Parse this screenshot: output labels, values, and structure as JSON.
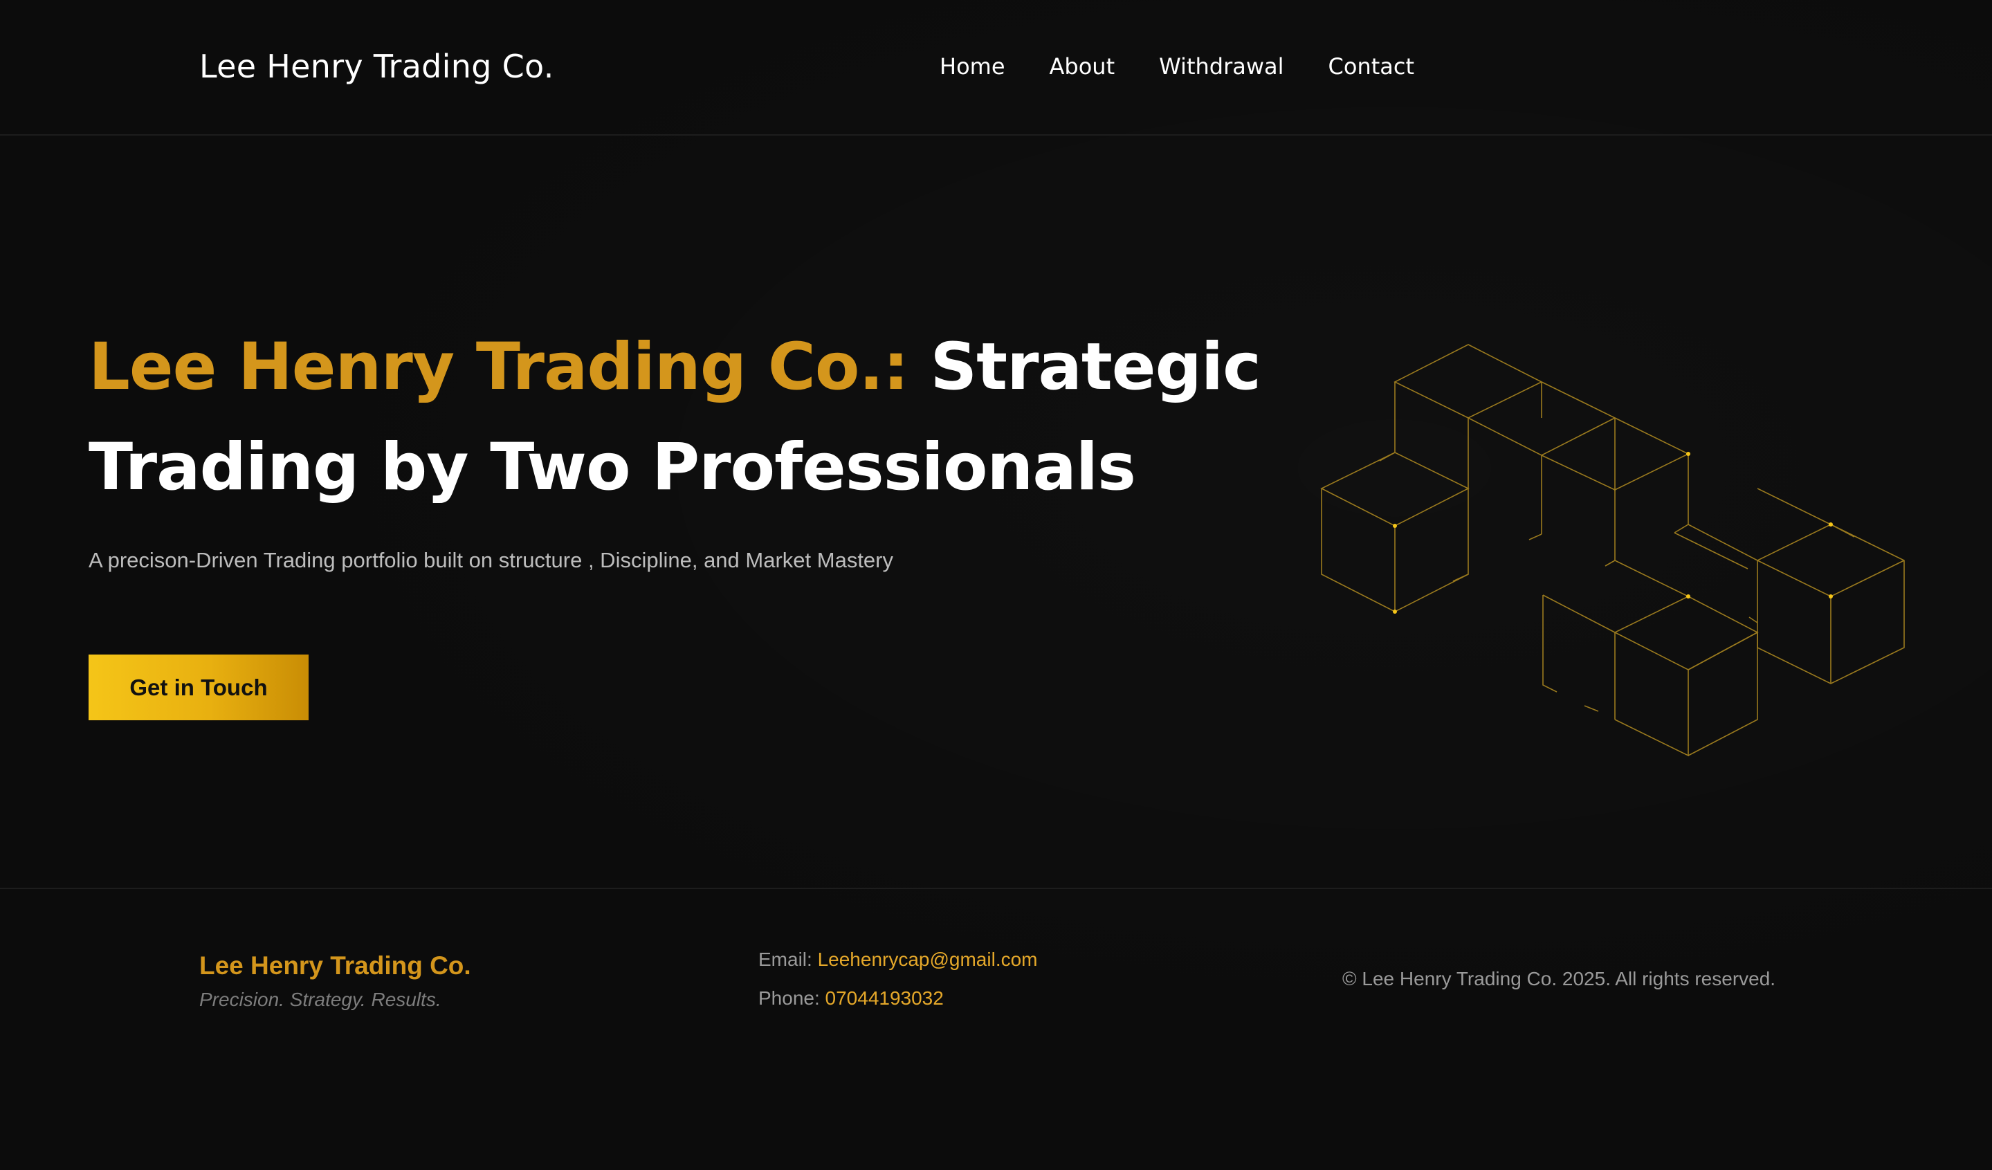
{
  "header": {
    "brand": "Lee Henry Trading Co.",
    "nav": [
      {
        "label": "Home"
      },
      {
        "label": "About"
      },
      {
        "label": "Withdrawal"
      },
      {
        "label": "Contact"
      }
    ]
  },
  "hero": {
    "title_accent": "Lee Henry Trading Co.:",
    "title_rest": "Strategic Trading by Two Professionals",
    "subtitle": "A precison-Driven Trading portfolio built on structure , Discipline, and Market Mastery",
    "cta_label": "Get in Touch",
    "graphic_icon": "isometric-cubes-graphic"
  },
  "footer": {
    "brand": "Lee Henry Trading Co.",
    "tagline": "Precision. Strategy. Results.",
    "email_label": "Email:",
    "email_value": "Leehenrycap@gmail.com",
    "phone_label": "Phone:",
    "phone_value": "07044193032",
    "copyright": "© Lee Henry Trading Co. 2025. All rights reserved."
  },
  "colors": {
    "background": "#0c0c0c",
    "accent": "#d4961c",
    "cta_gradient_start": "#f5c518",
    "cta_gradient_end": "#c98d05",
    "cube_line": "#9a7a1e",
    "cube_dot": "#f5c518"
  }
}
